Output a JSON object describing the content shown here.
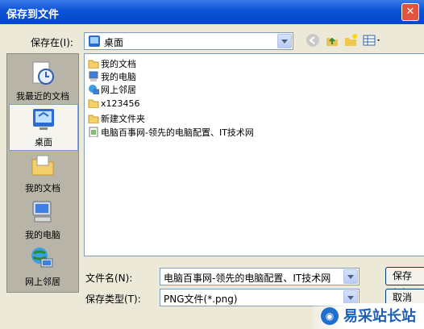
{
  "window": {
    "title": "保存到文件",
    "close_glyph": "✕"
  },
  "save_in": {
    "label": "保存在(I):",
    "value": "桌面"
  },
  "places": [
    {
      "label": "我最近的文档",
      "icon": "recent-docs-icon"
    },
    {
      "label": "桌面",
      "icon": "desktop-icon",
      "selected": true
    },
    {
      "label": "我的文档",
      "icon": "my-docs-icon"
    },
    {
      "label": "我的电脑",
      "icon": "my-computer-icon"
    },
    {
      "label": "网上邻居",
      "icon": "network-icon"
    }
  ],
  "files": [
    {
      "name": "我的文档",
      "icon": "my-docs-icon"
    },
    {
      "name": "我的电脑",
      "icon": "my-computer-icon"
    },
    {
      "name": "网上邻居",
      "icon": "network-icon"
    },
    {
      "name": "x123456",
      "icon": "folder-icon"
    },
    {
      "name": "新建文件夹",
      "icon": "folder-icon"
    },
    {
      "name": "电脑百事网-领先的电脑配置、IT技术网",
      "icon": "png-file-icon"
    }
  ],
  "filename": {
    "label": "文件名(N):",
    "value": "电脑百事网-领先的电脑配置、IT技术网"
  },
  "filetype": {
    "label": "保存类型(T):",
    "value": "PNG文件(*.png)"
  },
  "buttons": {
    "save": "保存(S)",
    "cancel": "取消"
  },
  "watermark": {
    "text": "易采站长站"
  }
}
